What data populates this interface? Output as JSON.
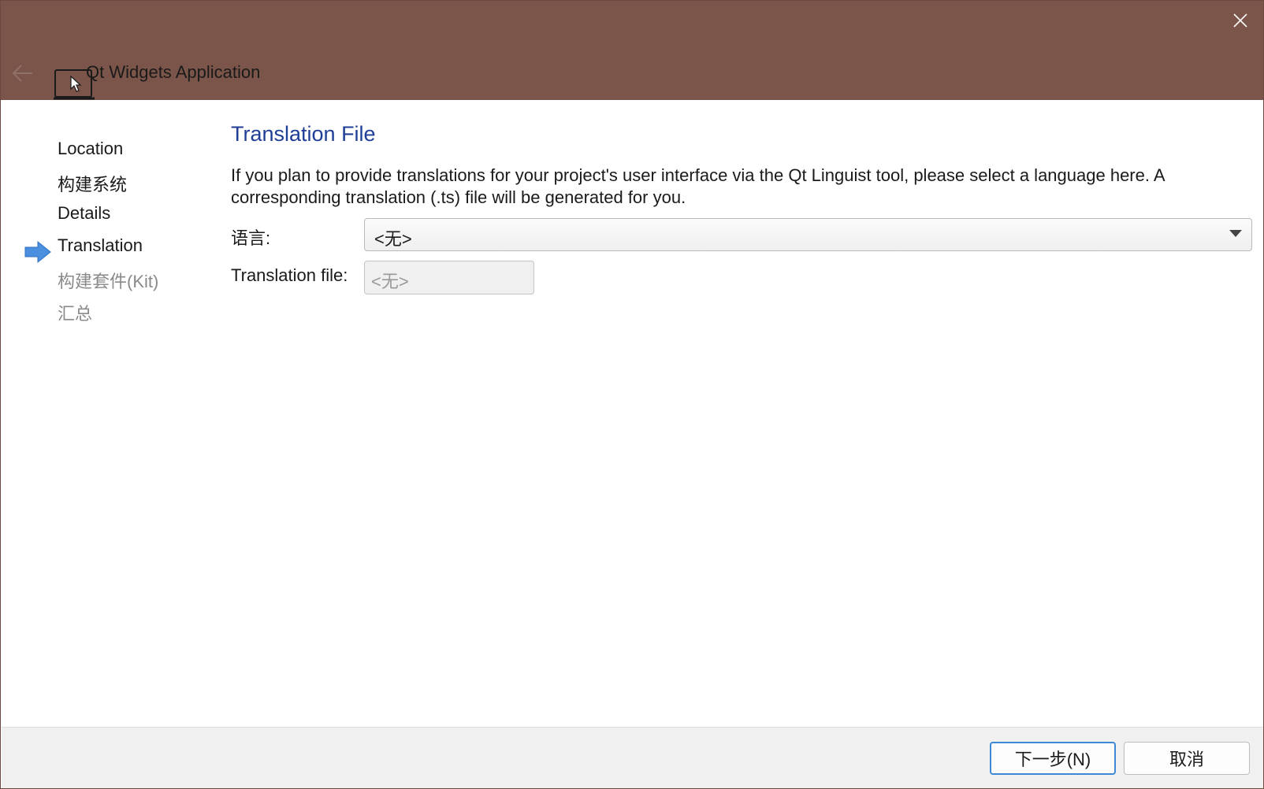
{
  "window": {
    "title": "Qt Widgets Application",
    "close_icon": "close-icon",
    "back_icon": "back-arrow-icon",
    "app_icon": "qt-widgets-app-icon",
    "titlebar_color": "#7b5549"
  },
  "steps": {
    "current_indicator_icon": "current-step-arrow-icon",
    "accent_color": "#4a8fe0",
    "items": [
      {
        "label": "Location",
        "state": "done"
      },
      {
        "label": "构建系统",
        "state": "done"
      },
      {
        "label": "Details",
        "state": "done"
      },
      {
        "label": "Translation",
        "state": "current"
      },
      {
        "label": "构建套件(Kit)",
        "state": "future"
      },
      {
        "label": "汇总",
        "state": "future"
      }
    ]
  },
  "page": {
    "title": "Translation File",
    "title_color": "#1f3f96",
    "description": "If you plan to provide translations for your project's user interface via the Qt Linguist tool, please select a language here. A corresponding translation (.ts) file will be generated for you.",
    "language_label": "语言:",
    "language_value": "<无>",
    "file_label": "Translation file:",
    "file_value": "<无>"
  },
  "footer": {
    "next_label": "下一步(N)",
    "cancel_label": "取消"
  }
}
